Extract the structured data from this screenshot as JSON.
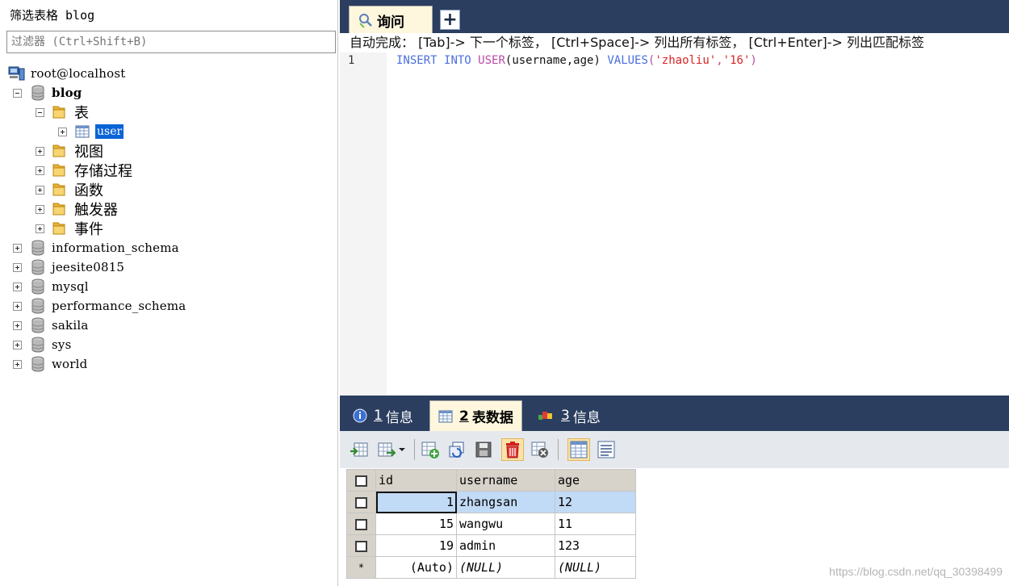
{
  "left_panel": {
    "title": "筛选表格 blog",
    "filter_placeholder": "过滤器 (Ctrl+Shift+B)",
    "tree": {
      "host": "root@localhost",
      "db_blog": "blog",
      "folder_tables": "表",
      "table_user": "user",
      "folder_views": "视图",
      "folder_procs": "存储过程",
      "folder_funcs": "函数",
      "folder_triggers": "触发器",
      "folder_events": "事件",
      "other_dbs": [
        "information_schema",
        "jeesite0815",
        "mysql",
        "performance_schema",
        "sakila",
        "sys",
        "world"
      ]
    }
  },
  "query": {
    "tab_label": "询问",
    "add_tab": "+",
    "hint": "自动完成： [Tab]-> 下一个标签， [Ctrl+Space]-> 列出所有标签， [Ctrl+Enter]-> 列出匹配标签",
    "line_number": "1",
    "code": {
      "kw1": "INSERT",
      "kw2": "INTO",
      "table": "USER",
      "cols": "(username,age)",
      "kw3": "VALUES",
      "open": "(",
      "s1": "'zhaoliu'",
      "comma": ",",
      "s2": "'16'",
      "close": ")"
    }
  },
  "result_tabs": [
    {
      "num": "1",
      "label": "信息"
    },
    {
      "num": "2",
      "label": "表数据"
    },
    {
      "num": "3",
      "label": "信息"
    }
  ],
  "grid": {
    "columns": [
      "id",
      "username",
      "age"
    ],
    "rows": [
      {
        "id": "1",
        "username": "zhangsan",
        "age": "12"
      },
      {
        "id": "15",
        "username": "wangwu",
        "age": "11"
      },
      {
        "id": "19",
        "username": "admin",
        "age": "123"
      }
    ],
    "new_row": {
      "marker": "*",
      "id": "(Auto)",
      "username": "(NULL)",
      "age": "(NULL)"
    }
  },
  "watermark": "https://blog.csdn.net/qq_30398499",
  "colors": {
    "tab_bar": "#2b3e5f",
    "active_tab": "#fef7de",
    "selection": "#0a64d6",
    "keyword": "#4a6fde",
    "string": "#dc2222",
    "table_name": "#b84aa6"
  }
}
